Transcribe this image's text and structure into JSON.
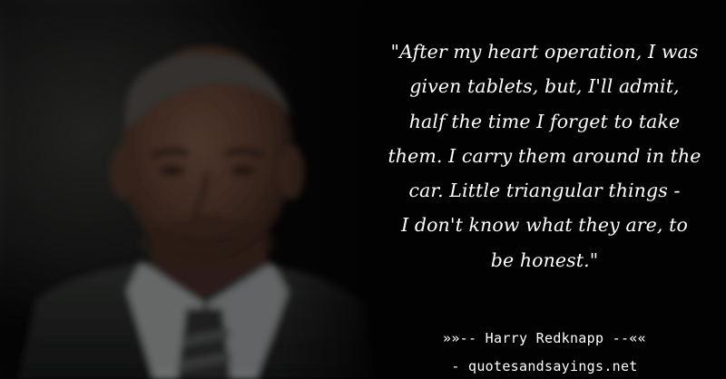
{
  "quote": {
    "lines": [
      "\"After my heart operation, I was",
      "given tablets, but, I'll admit,",
      "half the time I forget to take",
      "them. I carry them around in the",
      "car. Little triangular things -",
      "I don't know what they are, to",
      "be honest.\""
    ]
  },
  "attribution": {
    "author_line": "»»-- Harry Redknapp --««"
  },
  "site": {
    "credit": "- quotesandsayings.net"
  }
}
